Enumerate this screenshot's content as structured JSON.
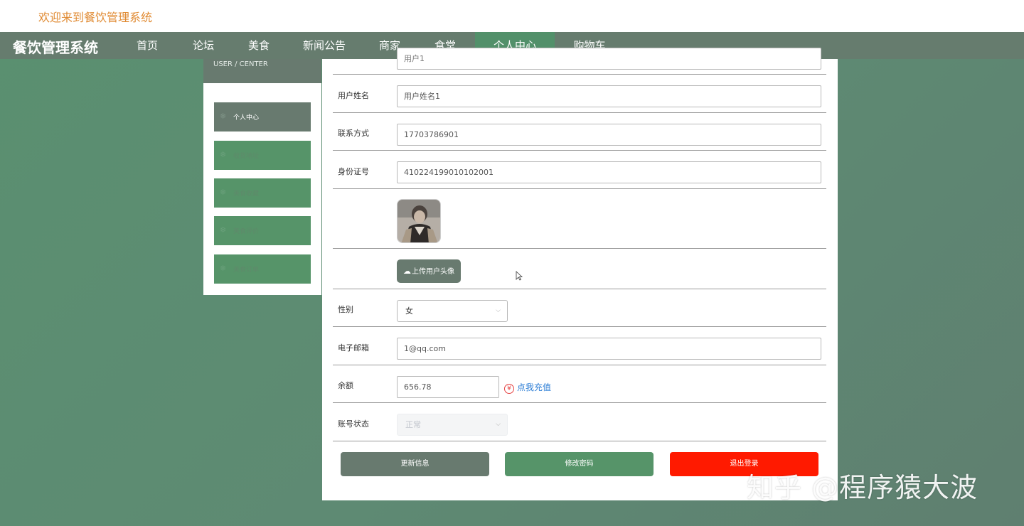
{
  "header": {
    "welcome": "欢迎来到餐饮管理系统",
    "brand": "餐饮管理系统"
  },
  "nav": {
    "items": [
      {
        "label": "首页"
      },
      {
        "label": "论坛"
      },
      {
        "label": "美食"
      },
      {
        "label": "新闻公告"
      },
      {
        "label": "商家"
      },
      {
        "label": "食堂"
      },
      {
        "label": "个人中心",
        "active": true
      },
      {
        "label": "购物车"
      }
    ]
  },
  "sidebar": {
    "title": "USER / CENTER",
    "items": [
      {
        "label": "个人中心",
        "active": true
      },
      {
        "label": "收货地址"
      },
      {
        "label": "美食收藏"
      },
      {
        "label": "美食评价"
      },
      {
        "label": "美食订单"
      }
    ]
  },
  "form": {
    "account_partial": "用户1",
    "name_label": "用户姓名",
    "name_value": "用户姓名1",
    "phone_label": "联系方式",
    "phone_value": "17703786901",
    "id_label": "身份证号",
    "id_value": "410224199010102001",
    "upload_label": "上传用户头像",
    "gender_label": "性别",
    "gender_value": "女",
    "email_label": "电子邮箱",
    "email_value": "1@qq.com",
    "balance_label": "余额",
    "balance_value": "656.78",
    "recharge_label": "点我充值",
    "recharge_symbol": "¥",
    "status_label": "账号状态",
    "status_value": "正常"
  },
  "actions": {
    "update": "更新信息",
    "change_password": "修改密码",
    "logout": "退出登录"
  },
  "watermark": "知乎 @程序猿大波",
  "colors": {
    "nav_bg": "#667c6e",
    "accent_green": "#569469",
    "logout_red": "#ff1a00",
    "welcome_orange": "#e08a32",
    "link_blue": "#2f7fd6"
  }
}
